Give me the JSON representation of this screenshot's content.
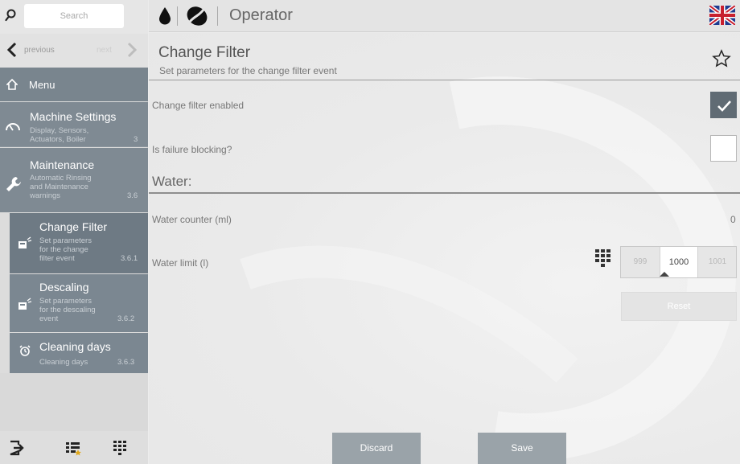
{
  "sidebar": {
    "search_placeholder": "Search",
    "nav": {
      "previous_label": "previous",
      "next_label": "next"
    },
    "menu_label": "Menu",
    "items": [
      {
        "title": "Machine Settings",
        "sub": [
          "Display, Sensors,",
          "Actuators, Boiler"
        ],
        "num": "3",
        "icon": "gauge-icon"
      },
      {
        "title": "Maintenance",
        "sub": [
          "Automatic Rinsing",
          "and Maintenance",
          "warnings"
        ],
        "num": "3.6",
        "icon": "wrench-icon"
      },
      {
        "title": "Change Filter",
        "sub": [
          "Set parameters",
          "for the change",
          "filter event"
        ],
        "num": "3.6.1",
        "icon": "filter-icon",
        "selected": true
      },
      {
        "title": "Descaling",
        "sub": [
          "Set parameters",
          "for the descaling",
          "event"
        ],
        "num": "3.6.2",
        "icon": "filter-icon"
      },
      {
        "title": "Cleaning days",
        "sub": [
          "Cleaning days"
        ],
        "num": "3.6.3",
        "icon": "alarm-clock-icon"
      }
    ],
    "bottom_icons": [
      "logout-icon",
      "favorites-list-icon",
      "keypad-icon"
    ]
  },
  "topbar": {
    "title": "Operator",
    "icons": [
      "water-drop-icon",
      "coffee-bean-icon",
      "uk-flag-icon"
    ]
  },
  "main": {
    "title": "Change Filter",
    "subtitle": "Set parameters for the change filter event",
    "fields": {
      "filter_enabled": {
        "label": "Change filter enabled",
        "checked": true
      },
      "failure_blocking": {
        "label": "Is failure blocking?",
        "checked": false
      }
    },
    "section_water": "Water:",
    "water_counter": {
      "label": "Water counter (ml)",
      "value": "0"
    },
    "water_limit": {
      "label": "Water limit (l)",
      "options": [
        "999",
        "1000",
        "1001"
      ],
      "selected": "1000"
    },
    "reset_label": "Reset",
    "discard_label": "Discard",
    "save_label": "Save"
  },
  "colors": {
    "sidebar_item": "#7f8a93",
    "sidebar_selected": "#6e7a84",
    "checkbox_checked": "#606b74",
    "footer_button": "#9aa3a9"
  }
}
